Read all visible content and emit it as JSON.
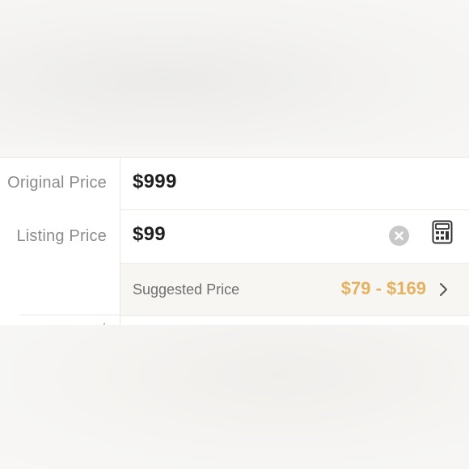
{
  "original_price": {
    "label": "Original Price",
    "value": "$999"
  },
  "listing_price": {
    "label": "Listing Price",
    "value": "$99",
    "clear_icon": "close-circle-icon",
    "calculator_icon": "calculator-icon"
  },
  "suggested_price": {
    "label": "Suggested Price",
    "range": "$79 - $169",
    "chevron_icon": "chevron-right-icon"
  },
  "colors": {
    "accent": "#e4b25e",
    "label_gray": "#8b8b8b",
    "value_dark": "#1f1f1f",
    "suggested_bg": "#f8f6f3"
  }
}
